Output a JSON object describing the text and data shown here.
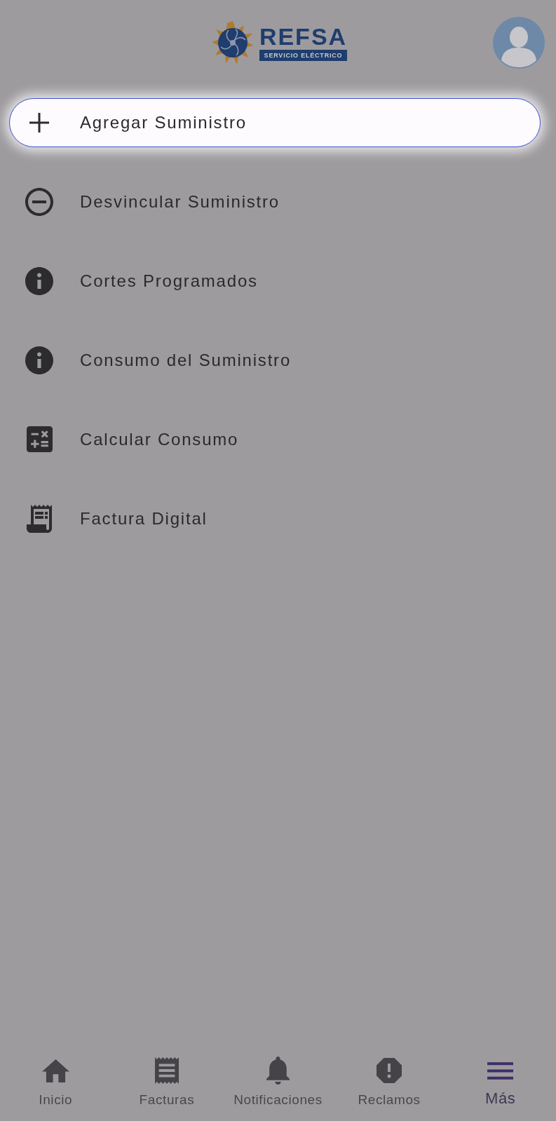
{
  "header": {
    "logo": {
      "name": "REFSA",
      "tagline": "SERVICIO ELÉCTRICO"
    }
  },
  "menu": [
    {
      "label": "Agregar Suministro",
      "highlighted": true
    },
    {
      "label": "Desvincular Suministro",
      "highlighted": false
    },
    {
      "label": "Cortes Programados",
      "highlighted": false
    },
    {
      "label": "Consumo del Suministro",
      "highlighted": false
    },
    {
      "label": "Calcular Consumo",
      "highlighted": false
    },
    {
      "label": "Factura Digital",
      "highlighted": false
    }
  ],
  "bottom_nav": [
    {
      "label": "Inicio",
      "selected": false
    },
    {
      "label": "Facturas",
      "selected": false
    },
    {
      "label": "Notificaciones",
      "selected": false
    },
    {
      "label": "Reclamos",
      "selected": false
    },
    {
      "label": "Más",
      "selected": true
    }
  ]
}
